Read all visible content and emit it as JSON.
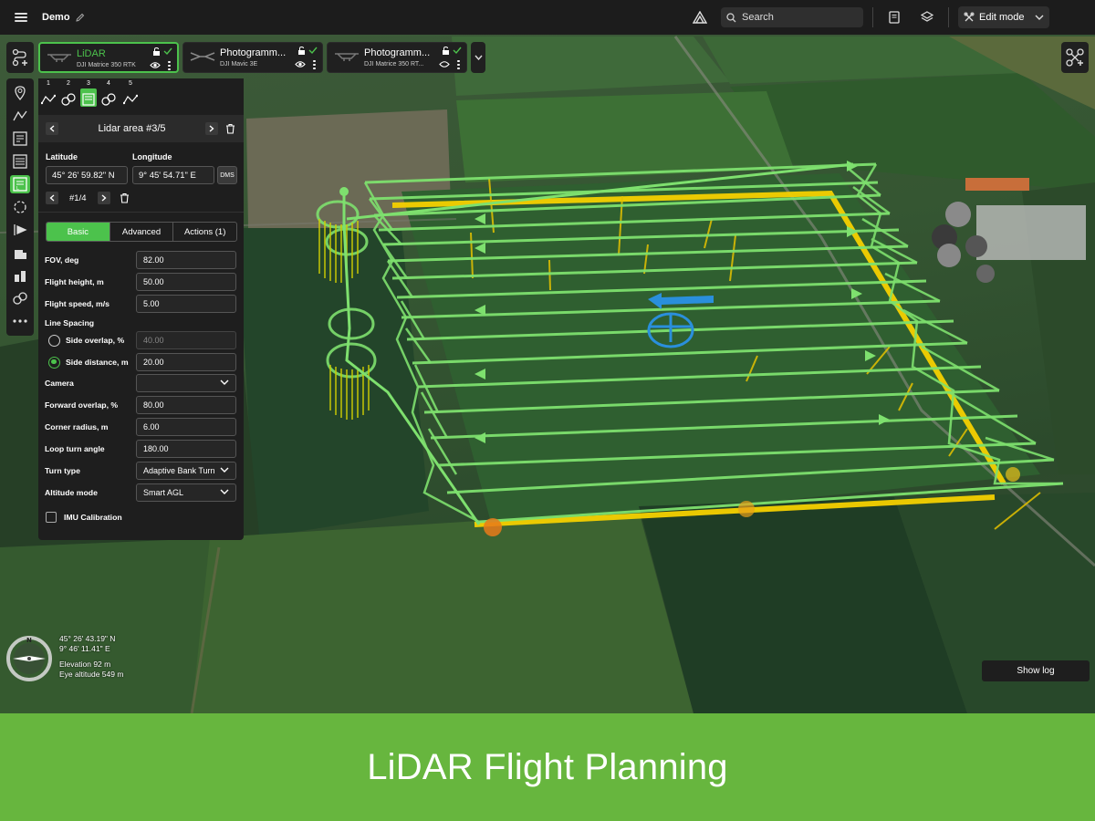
{
  "topbar": {
    "project_name": "Demo",
    "search_placeholder": "Search",
    "mode_label": "Edit mode"
  },
  "missions": [
    {
      "title": "LiDAR",
      "subtitle": "DJI Matrice 350 RTK",
      "active": true
    },
    {
      "title": "Photogramm...",
      "subtitle": "DJI Mavic 3E",
      "active": false
    },
    {
      "title": "Photogramm...",
      "subtitle": "DJI Matrice 350 RT...",
      "active": false
    }
  ],
  "steps": [
    "1",
    "2",
    "3",
    "4",
    "5"
  ],
  "panel": {
    "area_title": "Lidar area #3/5",
    "latitude_label": "Latitude",
    "longitude_label": "Longitude",
    "latitude_value": "45° 26' 59.82\" N",
    "longitude_value": "9° 45' 54.71\" E",
    "dms_label": "DMS",
    "point_label": "#1/4",
    "tabs": [
      "Basic",
      "Advanced",
      "Actions (1)"
    ],
    "properties": {
      "fov": {
        "label": "FOV, deg",
        "value": "82.00"
      },
      "flight_height": {
        "label": "Flight height, m",
        "value": "50.00"
      },
      "flight_speed": {
        "label": "Flight speed, m/s",
        "value": "5.00"
      },
      "line_spacing": {
        "label": "Line Spacing"
      },
      "side_overlap": {
        "label": "Side overlap, %",
        "value": "40.00"
      },
      "side_distance": {
        "label": "Side distance, m",
        "value": "20.00"
      },
      "camera": {
        "label": "Camera",
        "value": ""
      },
      "forward_overlap": {
        "label": "Forward overlap, %",
        "value": "80.00"
      },
      "corner_radius": {
        "label": "Corner radius, m",
        "value": "6.00"
      },
      "loop_turn_angle": {
        "label": "Loop turn angle",
        "value": "180.00"
      },
      "turn_type": {
        "label": "Turn type",
        "value": "Adaptive Bank Turn"
      },
      "altitude_mode": {
        "label": "Altitude mode",
        "value": "Smart AGL"
      },
      "imu_calibration": {
        "label": "IMU Calibration"
      }
    }
  },
  "map_readout": {
    "lat": "45° 26' 43.19\" N",
    "lon": "9° 46' 11.41\" E",
    "elevation": "Elevation 92 m",
    "eye_altitude": "Eye altitude 549 m",
    "compass_n": "N"
  },
  "show_log_label": "Show log",
  "banner_title": "LiDAR Flight Planning",
  "colors": {
    "accent": "#4cc24c",
    "banner": "#67b63e",
    "flight_line": "#7ee06e",
    "area_outline": "#f5d000",
    "waypoint": "#2a8fdc"
  }
}
